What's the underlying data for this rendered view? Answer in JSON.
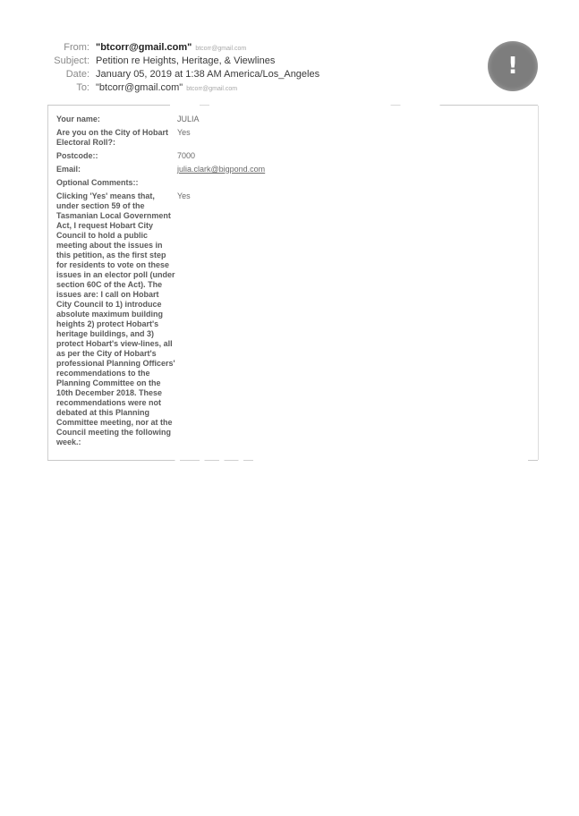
{
  "email_header": {
    "from": {
      "label": "From:",
      "name": "\"btcorr@gmail.com\"",
      "address": "btcorr@gmail.com"
    },
    "subject": {
      "label": "Subject:",
      "value": "Petition re Heights, Heritage, & Viewlines"
    },
    "date": {
      "label": "Date:",
      "value": "January 05, 2019 at 1:38 AM America/Los_Angeles"
    },
    "to": {
      "label": "To:",
      "name": "\"btcorr@gmail.com\"",
      "address": "btcorr@gmail.com"
    }
  },
  "alert_badge": {
    "icon": "exclamation-icon",
    "glyph": "!"
  },
  "form": {
    "rows": [
      {
        "label": "Your name:",
        "value": "JULIA"
      },
      {
        "label": "Are you on the City of Hobart Electoral Roll?:",
        "value": "Yes"
      },
      {
        "label": "Postcode::",
        "value": "7000"
      },
      {
        "label": "Email:",
        "value": "julia.clark@bigpond.com"
      },
      {
        "label": "Optional Comments::",
        "value": ""
      },
      {
        "label": "Clicking 'Yes' means that, under section 59 of the Tasmanian Local Government Act, I request Hobart City Council to hold a public meeting about the issues in this petition, as the first step for residents to vote on these issues in an elector poll (under section 60C of the Act). The issues are: I call on Hobart City Council to 1) introduce absolute maximum building heights 2) protect Hobart's heritage buildings, and 3) protect Hobart's view-lines, all as per the City of Hobart's professional Planning Officers' recommendations to the Planning Committee on the 10th December 2018. These recommendations were not debated at this Planning Committee meeting, nor at the Council meeting the following week.:",
        "value": "Yes"
      }
    ]
  }
}
